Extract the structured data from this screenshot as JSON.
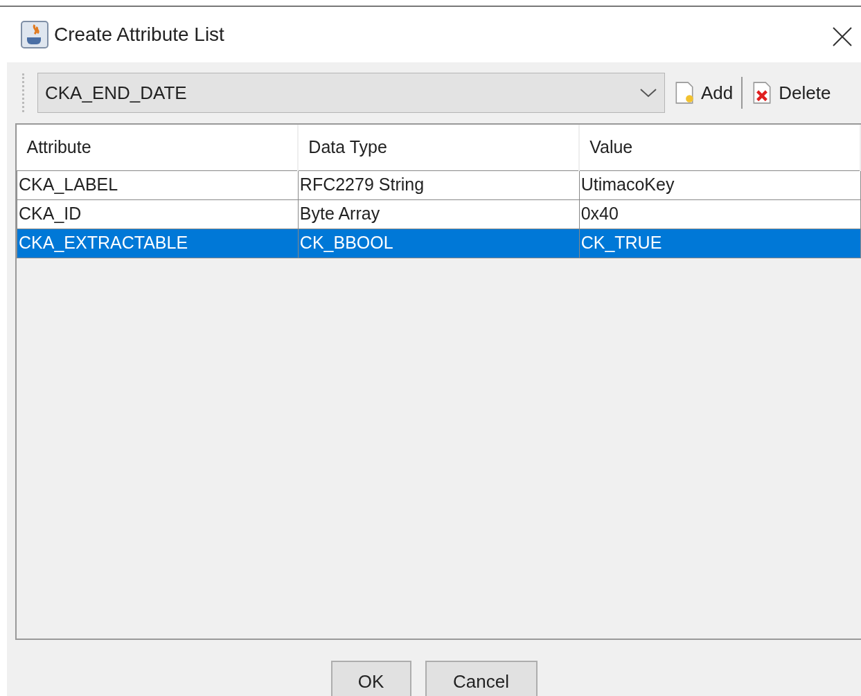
{
  "window": {
    "title": "Create Attribute List"
  },
  "toolbar": {
    "attribute_select": {
      "value": "CKA_END_DATE"
    },
    "buttons": [
      {
        "kind": "add",
        "label": "Add"
      },
      {
        "kind": "delete",
        "label": "Delete"
      }
    ]
  },
  "table": {
    "columns": [
      "Attribute",
      "Data Type",
      "Value"
    ],
    "rows": [
      {
        "cells": [
          "CKA_LABEL",
          "RFC2279 String",
          "UtimacoKey"
        ],
        "selected": false
      },
      {
        "cells": [
          "CKA_ID",
          "Byte Array",
          "0x40"
        ],
        "selected": false
      },
      {
        "cells": [
          "CKA_EXTRACTABLE",
          "CK_BBOOL",
          "CK_TRUE"
        ],
        "selected": true
      }
    ]
  },
  "buttons": [
    "OK",
    "Cancel"
  ]
}
